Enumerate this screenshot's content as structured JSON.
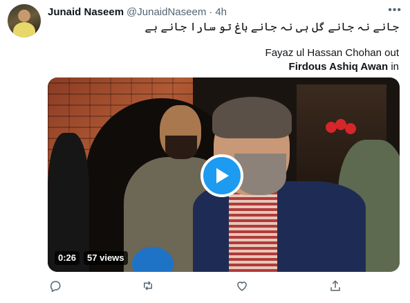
{
  "tweet": {
    "display_name": "Junaid Naseem",
    "handle": "@JunaidNaseem",
    "separator": "·",
    "time": "4h",
    "text_urdu": "جانے نہ جانے گل ہی نہ جانے باغ تو سارا جانے ہے",
    "text_line2": "Fayaz ul Hassan Chohan out",
    "text_line3_bold": "Firdous Ashiq Awan",
    "text_line3_rest": " in"
  },
  "media": {
    "duration": "0:26",
    "views": "57 views"
  },
  "icons": {
    "more": "more-icon",
    "play": "play-icon",
    "reply": "reply-icon",
    "retweet": "retweet-icon",
    "like": "like-icon",
    "share": "share-icon"
  },
  "colors": {
    "accent": "#1d9bf0",
    "text": "#0f1419",
    "secondary": "#536471"
  }
}
